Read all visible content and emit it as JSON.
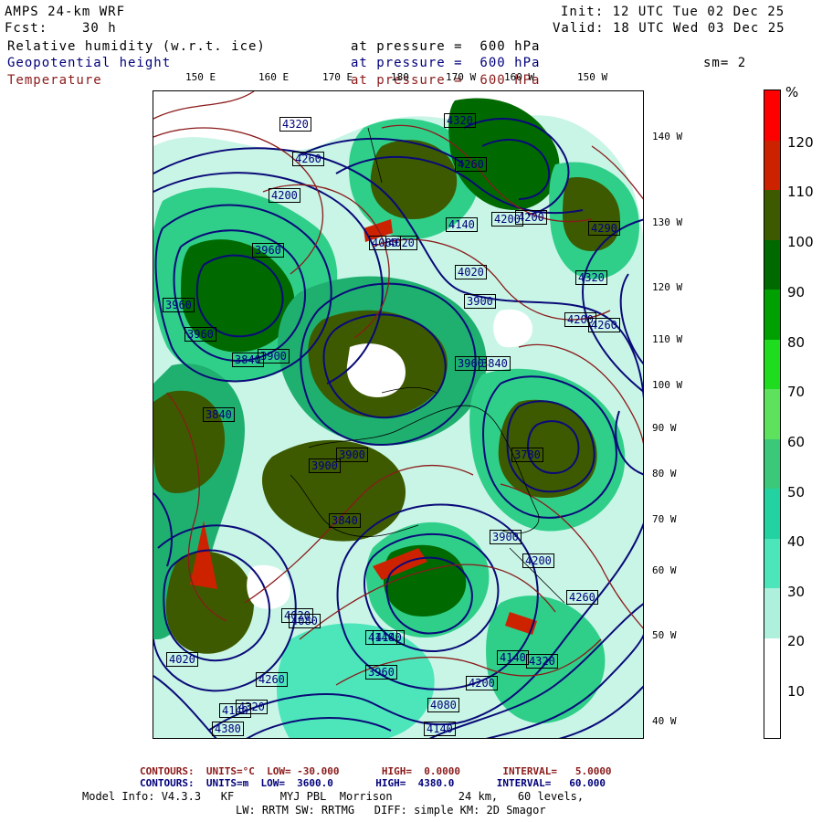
{
  "header": {
    "model": "AMPS 24-km WRF",
    "fcst_label": "Fcst:",
    "fcst_value": "30 h",
    "init": "Init: 12 UTC Tue 02 Dec 25",
    "valid": "Valid: 18 UTC Wed 03 Dec 25",
    "field1_name": "Relative humidity (w.r.t. ice)",
    "field1_level": "at pressure =  600 hPa",
    "field2_name": "Geopotential height",
    "field2_level": "at pressure =  600 hPa",
    "field3_name": "Temperature",
    "field3_level": "at pressure =  600 hPa",
    "smoothing": "sm= 2"
  },
  "lon_labels": [
    "150 E",
    "160 E",
    "170 E",
    "180",
    "170 W",
    "160 W",
    "150 W"
  ],
  "lat_labels": [
    "140 W",
    "130 W",
    "120 W",
    "110 W",
    "100 W",
    "90 W",
    "80 W",
    "70 W",
    "60 W",
    "50 W",
    "40 W"
  ],
  "colorbar": {
    "unit": "%",
    "ticks": [
      "120",
      "110",
      "100",
      "90",
      "80",
      "70",
      "60",
      "50",
      "40",
      "30",
      "20",
      "10"
    ],
    "colors": [
      "#ff0000",
      "#cc2200",
      "#3d5a00",
      "#006a00",
      "#00a000",
      "#1fdc1f",
      "#5ee25e",
      "#3cc87a",
      "#22d2a0",
      "#4de6bb",
      "#aef0dc",
      "#ffffff",
      "#ffffff"
    ]
  },
  "colors": {
    "height_contour": "#0a0a78",
    "temp_contour": "#8b1a1a",
    "temp_text": "#8b1a1a",
    "height_text": "#00007a"
  },
  "map_labels": [
    "4320",
    "4320",
    "4260",
    "4260",
    "4200",
    "4200",
    "4200",
    "4290",
    "4320",
    "4140",
    "4020",
    "4080",
    "3960",
    "4020",
    "3900",
    "3840",
    "3960",
    "3960",
    "3900",
    "3840",
    "3840",
    "3900",
    "3780",
    "3840",
    "3960",
    "3900",
    "4020",
    "4080",
    "4140",
    "4200",
    "4260",
    "4320",
    "4380",
    "4140",
    "4200",
    "4260",
    "4020",
    "3960",
    "4140",
    "4080",
    "4140",
    "4320",
    "4200",
    "4260",
    "3900",
    "4140"
  ],
  "footer": {
    "temp_line": "CONTOURS:  UNITS=°C  LOW= -30.000       HIGH=  0.0000       INTERVAL=   5.0000",
    "height_line": "CONTOURS:  UNITS=m  LOW=  3600.0       HIGH=  4380.0       INTERVAL=   60.000",
    "model_info": "Model Info: V4.3.3   KF       MYJ PBL  Morrison          24 km,   60 levels,",
    "physics": "LW: RRTM SW: RRTMG   DIFF: simple KM: 2D Smagor"
  }
}
